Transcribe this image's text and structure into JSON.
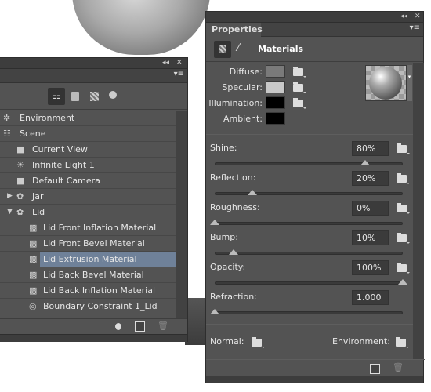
{
  "scene_panel": {
    "title_controls": {
      "collapse": "◂◂",
      "close": "✕"
    },
    "filter_icons": [
      "whole-scene-icon",
      "meshes-icon",
      "materials-icon",
      "lights-icon"
    ],
    "items": [
      {
        "label": "Environment",
        "icon": "environment-icon",
        "indent": 0
      },
      {
        "label": "Scene",
        "icon": "scene-icon",
        "indent": 0
      },
      {
        "label": "Current View",
        "icon": "camera-icon",
        "indent": 1
      },
      {
        "label": "Infinite Light 1",
        "icon": "light-icon",
        "indent": 1
      },
      {
        "label": "Default Camera",
        "icon": "camera-icon",
        "indent": 1
      },
      {
        "label": "Jar",
        "icon": "mesh-icon",
        "indent": 1,
        "expander": "collapsed"
      },
      {
        "label": "Lid",
        "icon": "mesh-icon",
        "indent": 1,
        "expander": "expanded"
      },
      {
        "label": "Lid Front Inflation Material",
        "icon": "material-icon",
        "indent": 2
      },
      {
        "label": "Lid Front Bevel Material",
        "icon": "material-icon",
        "indent": 2
      },
      {
        "label": "Lid Extrusion Material",
        "icon": "material-icon",
        "indent": 2,
        "selected": true
      },
      {
        "label": "Lid Back Bevel Material",
        "icon": "material-icon",
        "indent": 2
      },
      {
        "label": "Lid Back Inflation Material",
        "icon": "material-icon",
        "indent": 2
      },
      {
        "label": "Boundary Constraint 1_Lid",
        "icon": "constraint-icon",
        "indent": 2
      }
    ]
  },
  "properties_panel": {
    "tab": "Properties",
    "section": "Materials",
    "colors": [
      {
        "label": "Diffuse:",
        "color": "#7a7a7a"
      },
      {
        "label": "Specular:",
        "color": "#c8c8c8"
      },
      {
        "label": "Illumination:",
        "color": "#000000"
      },
      {
        "label": "Ambient:",
        "color": "#000000"
      }
    ],
    "sliders": [
      {
        "label": "Shine:",
        "value": "80%",
        "fraction": 0.8
      },
      {
        "label": "Reflection:",
        "value": "20%",
        "fraction": 0.2
      },
      {
        "label": "Roughness:",
        "value": "0%",
        "fraction": 0
      },
      {
        "label": "Bump:",
        "value": "10%",
        "fraction": 0.1
      },
      {
        "label": "Opacity:",
        "value": "100%",
        "fraction": 1
      },
      {
        "label": "Refraction:",
        "value": "1.000",
        "fraction": 0
      }
    ],
    "normal_label": "Normal:",
    "environment_label": "Environment:"
  },
  "colors": {
    "panel": "#535353",
    "selection": "#6f8199"
  }
}
